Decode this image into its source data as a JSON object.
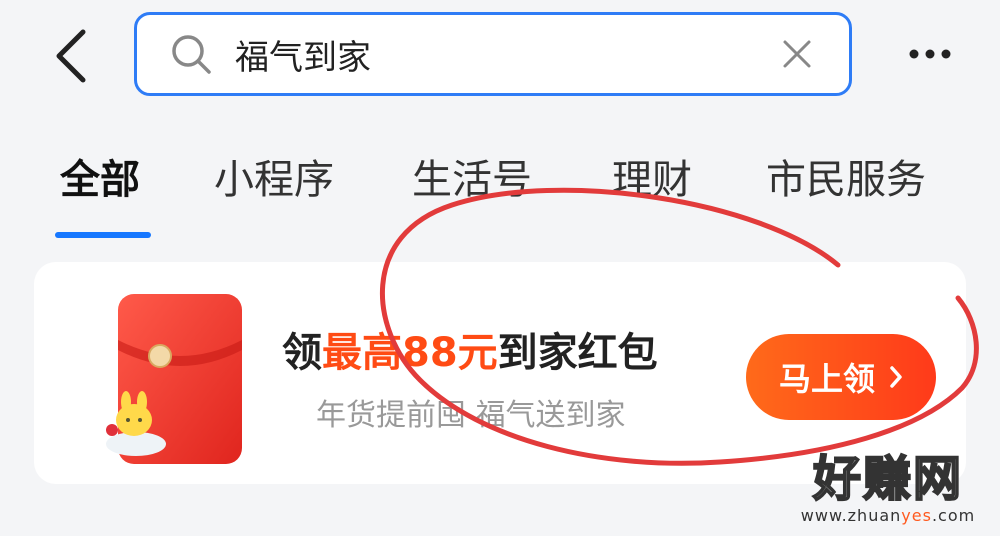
{
  "header": {
    "search": {
      "query": "福气到家"
    }
  },
  "tabs": [
    {
      "label": "全部",
      "active": true
    },
    {
      "label": "小程序",
      "active": false
    },
    {
      "label": "生活号",
      "active": false
    },
    {
      "label": "理财",
      "active": false
    },
    {
      "label": "市民服务",
      "active": false
    }
  ],
  "promo": {
    "headline_prefix": "领",
    "headline_highlight": "最高88元",
    "headline_suffix": "到家红包",
    "subtitle": "年货提前囤 福气送到家",
    "button_label": "马上领"
  },
  "watermark": {
    "title": "好赚网",
    "url_prefix": "www.zhuan",
    "url_accent": "yes",
    "url_suffix": ".com"
  },
  "colors": {
    "accent_blue": "#1677ff",
    "promo_orange": "#ff4b14",
    "annotation_red": "#e23b3b"
  }
}
